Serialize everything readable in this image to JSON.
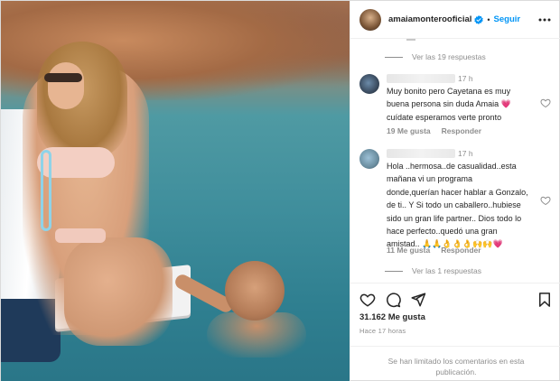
{
  "post": {
    "username": "amaiamonterooficial",
    "separator": "•",
    "follow_label": "Seguir"
  },
  "comments": {
    "top_replies": "Ver las 19 respuestas",
    "items": [
      {
        "time": "17 h",
        "text": "Muy bonito pero Cayetana es muy\nbuena persona sin duda Amaia 💗\ncuídate esperamos verte pronto",
        "likes": "19 Me gusta",
        "reply_label": "Responder"
      },
      {
        "time": "17 h",
        "text": "Hola ..hermosa..de casualidad..esta\nmañana vi un programa\ndonde,querían hacer hablar a Gonzalo,\nde ti.. Y Si todo un caballero..hubiese\nsido un gran life partner.. Dios todo lo\nhace perfecto..quedó una gran\namistad.. 🙏🙏👌👌👌🙌🙌💗",
        "likes": "11 Me gusta",
        "reply_label": "Responder"
      }
    ],
    "bottom_replies": "Ver las 1 respuestas"
  },
  "actions": {
    "likes_count": "31.162 Me gusta",
    "posted_ago": "Hace 17 horas",
    "limited_notice": "Se han limitado los comentarios en esta publicación."
  },
  "colors": {
    "accent": "#0095f6",
    "secondary_text": "#8e8e8e",
    "heart": "#ed4956"
  }
}
